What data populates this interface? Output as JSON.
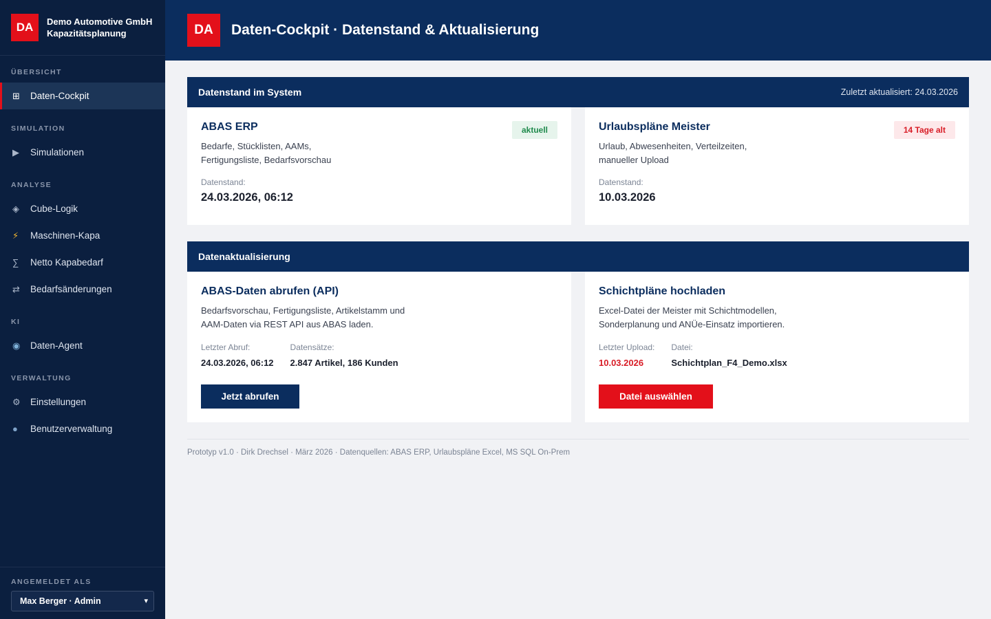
{
  "brand": {
    "logo": "DA",
    "company": "Demo Automotive GmbH",
    "app": "Kapazitätsplanung"
  },
  "sidebar": {
    "sections": [
      {
        "title": "ÜBERSICHT"
      },
      {
        "title": "SIMULATION"
      },
      {
        "title": "ANALYSE"
      },
      {
        "title": "KI"
      },
      {
        "title": "VERWALTUNG"
      }
    ],
    "items": [
      {
        "label": "Daten-Cockpit",
        "icon": "grid-icon",
        "glyph": "⊞",
        "active": true
      },
      {
        "label": "Simulationen",
        "icon": "play-icon",
        "glyph": "▶"
      },
      {
        "label": "Cube-Logik",
        "icon": "diamond-icon",
        "glyph": "◈"
      },
      {
        "label": "Maschinen-Kapa",
        "icon": "lightning-icon",
        "glyph": "⚡"
      },
      {
        "label": "Netto Kapabedarf",
        "icon": "sigma-icon",
        "glyph": "∑"
      },
      {
        "label": "Bedarfsänderungen",
        "icon": "swap-icon",
        "glyph": "⇄"
      },
      {
        "label": "Daten-Agent",
        "icon": "robot-icon",
        "glyph": "◉"
      },
      {
        "label": "Einstellungen",
        "icon": "gear-icon",
        "glyph": "⚙"
      },
      {
        "label": "Benutzerverwaltung",
        "icon": "user-icon",
        "glyph": "●"
      }
    ],
    "footer": {
      "label": "ANGEMELDET ALS",
      "user": "Max Berger · Admin"
    }
  },
  "header": {
    "logo": "DA",
    "title": "Daten-Cockpit · Datenstand & Aktualisierung"
  },
  "datenstand": {
    "title": "Datenstand im System",
    "updated": "Zuletzt aktualisiert: 24.03.2026",
    "cards": [
      {
        "title": "ABAS ERP",
        "badge": "aktuell",
        "desc": "Bedarfe, Stücklisten, AAMs, Fertigungsliste, Bedarfsvorschau",
        "label": "Datenstand:",
        "value": "24.03.2026, 06:12"
      },
      {
        "title": "Urlaubspläne Meister",
        "badge": "14 Tage alt",
        "desc": "Urlaub, Abwesenheiten, Verteilzeiten, manueller Upload",
        "label": "Datenstand:",
        "value": "10.03.2026"
      }
    ]
  },
  "aktualisierung": {
    "title": "Datenaktualisierung",
    "cards": [
      {
        "title": "ABAS-Daten abrufen (API)",
        "desc": "Bedarfsvorschau, Fertigungsliste, Artikelstamm und AAM-Daten via REST API aus ABAS laden.",
        "k1": "Letzter Abruf:",
        "v1": "24.03.2026, 06:12",
        "k2": "Datensätze:",
        "v2": "2.847 Artikel, 186 Kunden",
        "button": "Jetzt abrufen"
      },
      {
        "title": "Schichtpläne hochladen",
        "desc": "Excel-Datei der Meister mit Schichtmodellen, Sonderplanung und ANÜe-Einsatz importieren.",
        "k1": "Letzter Upload:",
        "v1": "10.03.2026",
        "k2": "Datei:",
        "v2": "Schichtplan_F4_Demo.xlsx",
        "button": "Datei auswählen"
      }
    ]
  },
  "footer": "Prototyp v1.0 · Dirk Drechsel · März 2026 · Datenquellen: ABAS ERP, Urlaubspläne Excel, MS SQL On-Prem",
  "colors": {
    "navy": "#0b2d5e",
    "sidebar": "#0b1f3f",
    "accent_red": "#e3101a",
    "ok_green": "#1f8a4c"
  }
}
